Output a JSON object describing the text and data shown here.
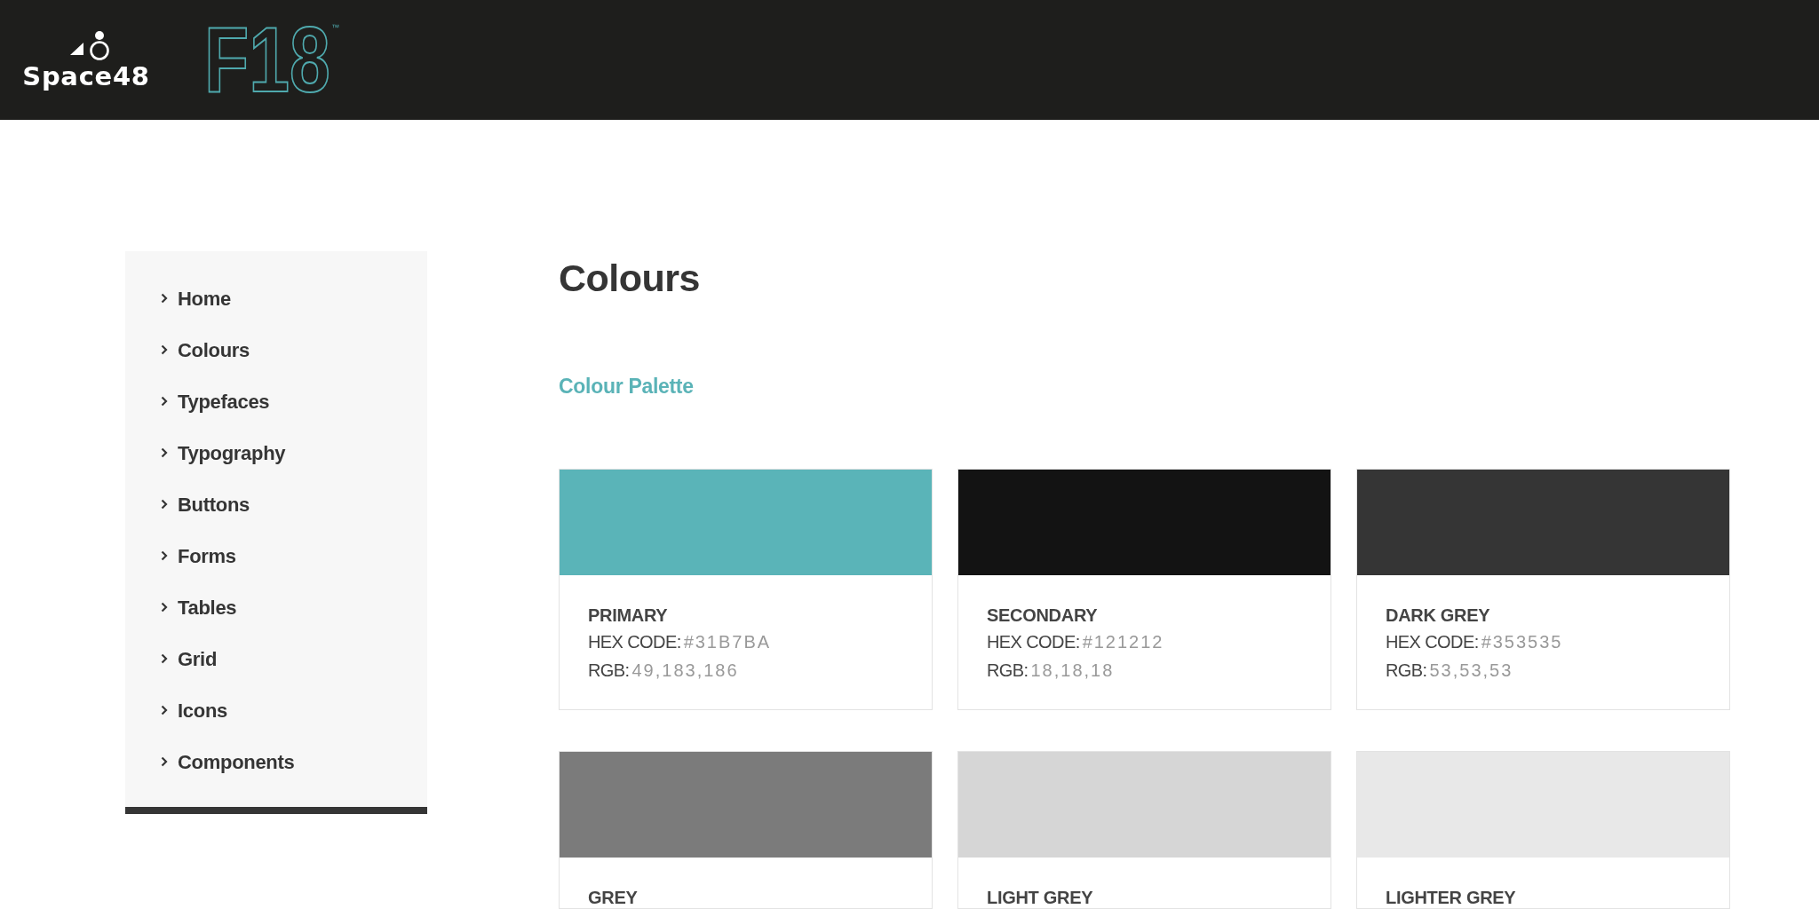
{
  "header": {
    "brand": {
      "name": "Space48"
    },
    "product_logo": {
      "text": "F18",
      "mark": "™"
    }
  },
  "sidebar": {
    "items": [
      {
        "label": "Home"
      },
      {
        "label": "Colours"
      },
      {
        "label": "Typefaces"
      },
      {
        "label": "Typography"
      },
      {
        "label": "Buttons"
      },
      {
        "label": "Forms"
      },
      {
        "label": "Tables"
      },
      {
        "label": "Grid"
      },
      {
        "label": "Icons"
      },
      {
        "label": "Components"
      }
    ]
  },
  "page": {
    "title": "Colours",
    "section_title": "Colour Palette",
    "swatches": [
      {
        "name": "PRIMARY",
        "color": "#5ab4b8",
        "hex_label": "HEX CODE:",
        "hex": "#31B7BA",
        "rgb_label": "RGB:",
        "rgb": "49,183,186"
      },
      {
        "name": "SECONDARY",
        "color": "#131313",
        "hex_label": "HEX CODE:",
        "hex": "#121212",
        "rgb_label": "RGB:",
        "rgb": "18,18,18"
      },
      {
        "name": "DARK GREY",
        "color": "#353535",
        "hex_label": "HEX CODE:",
        "hex": "#353535",
        "rgb_label": "RGB:",
        "rgb": "53,53,53"
      },
      {
        "name": "GREY",
        "color": "#7b7b7b"
      },
      {
        "name": "LIGHT GREY",
        "color": "#d6d6d6"
      },
      {
        "name": "LIGHTER GREY",
        "color": "#e8e8e8"
      }
    ]
  }
}
